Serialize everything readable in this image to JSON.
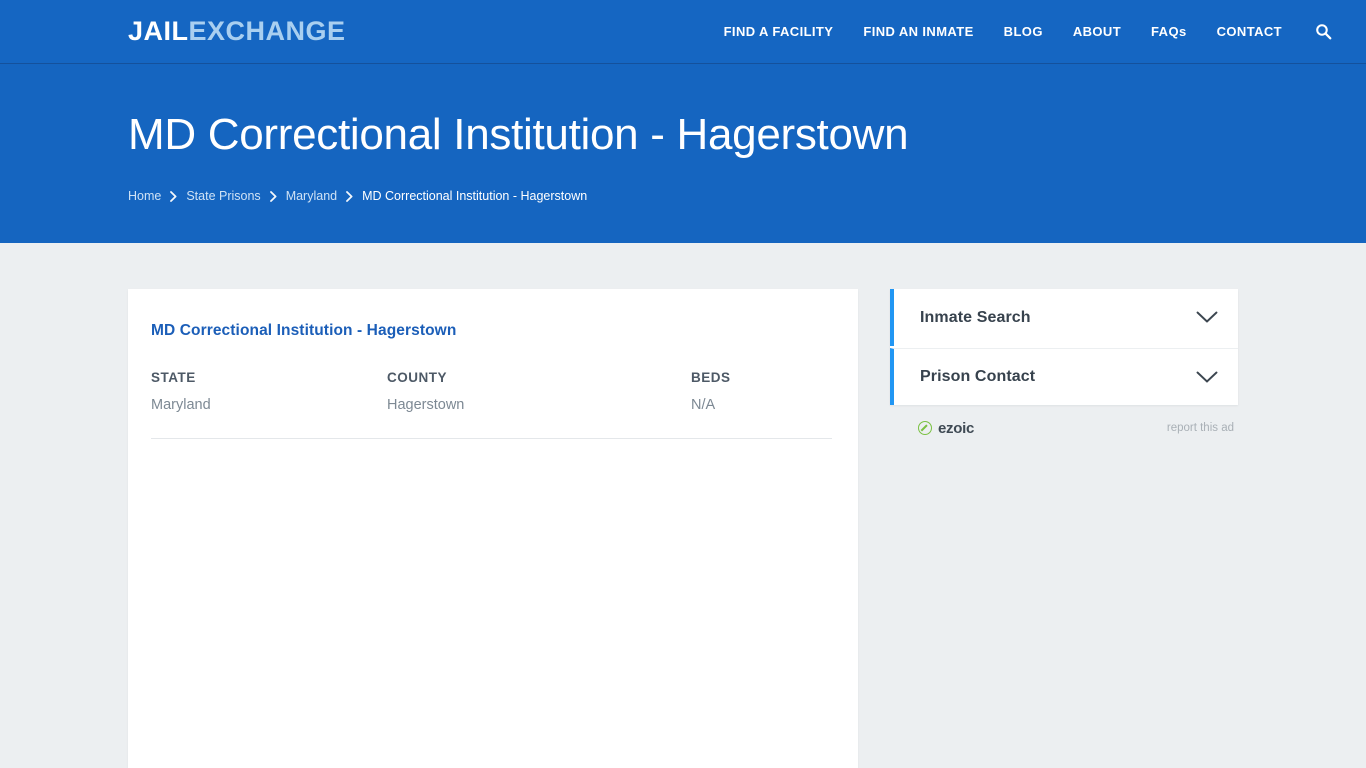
{
  "site": {
    "logo_primary": "JAIL",
    "logo_secondary": "EXCHANGE",
    "accent_blue": "#1565c0",
    "nav_blue": "#1566c2",
    "page_bg": "#eceff1",
    "panel_accent": "#2196f3",
    "link_blue": "#1b5eb8"
  },
  "nav": {
    "items": [
      {
        "label": "FIND A FACILITY"
      },
      {
        "label": "FIND AN INMATE"
      },
      {
        "label": "BLOG"
      },
      {
        "label": "ABOUT"
      },
      {
        "label": "FAQs"
      },
      {
        "label": "CONTACT"
      }
    ],
    "search_icon": "search-icon"
  },
  "hero": {
    "title": "MD Correctional Institution - Hagerstown",
    "breadcrumb": [
      {
        "label": "Home",
        "current": false
      },
      {
        "label": "State Prisons",
        "current": false
      },
      {
        "label": "Maryland",
        "current": false
      },
      {
        "label": "MD Correctional Institution - Hagerstown",
        "current": true
      }
    ]
  },
  "main": {
    "card_heading": "MD Correctional Institution - Hagerstown",
    "facts": [
      {
        "label": "STATE",
        "value": "Maryland"
      },
      {
        "label": "COUNTY",
        "value": "Hagerstown"
      },
      {
        "label": "BEDS",
        "value": "N/A"
      }
    ]
  },
  "sidebar": {
    "panels": [
      {
        "title": "Inmate Search",
        "icon": "chevron-down-icon",
        "expanded": false
      },
      {
        "title": "Prison Contact",
        "icon": "chevron-down-icon",
        "expanded": false
      }
    ],
    "ad": {
      "provider": "ezoic",
      "report_label": "report this ad"
    }
  }
}
